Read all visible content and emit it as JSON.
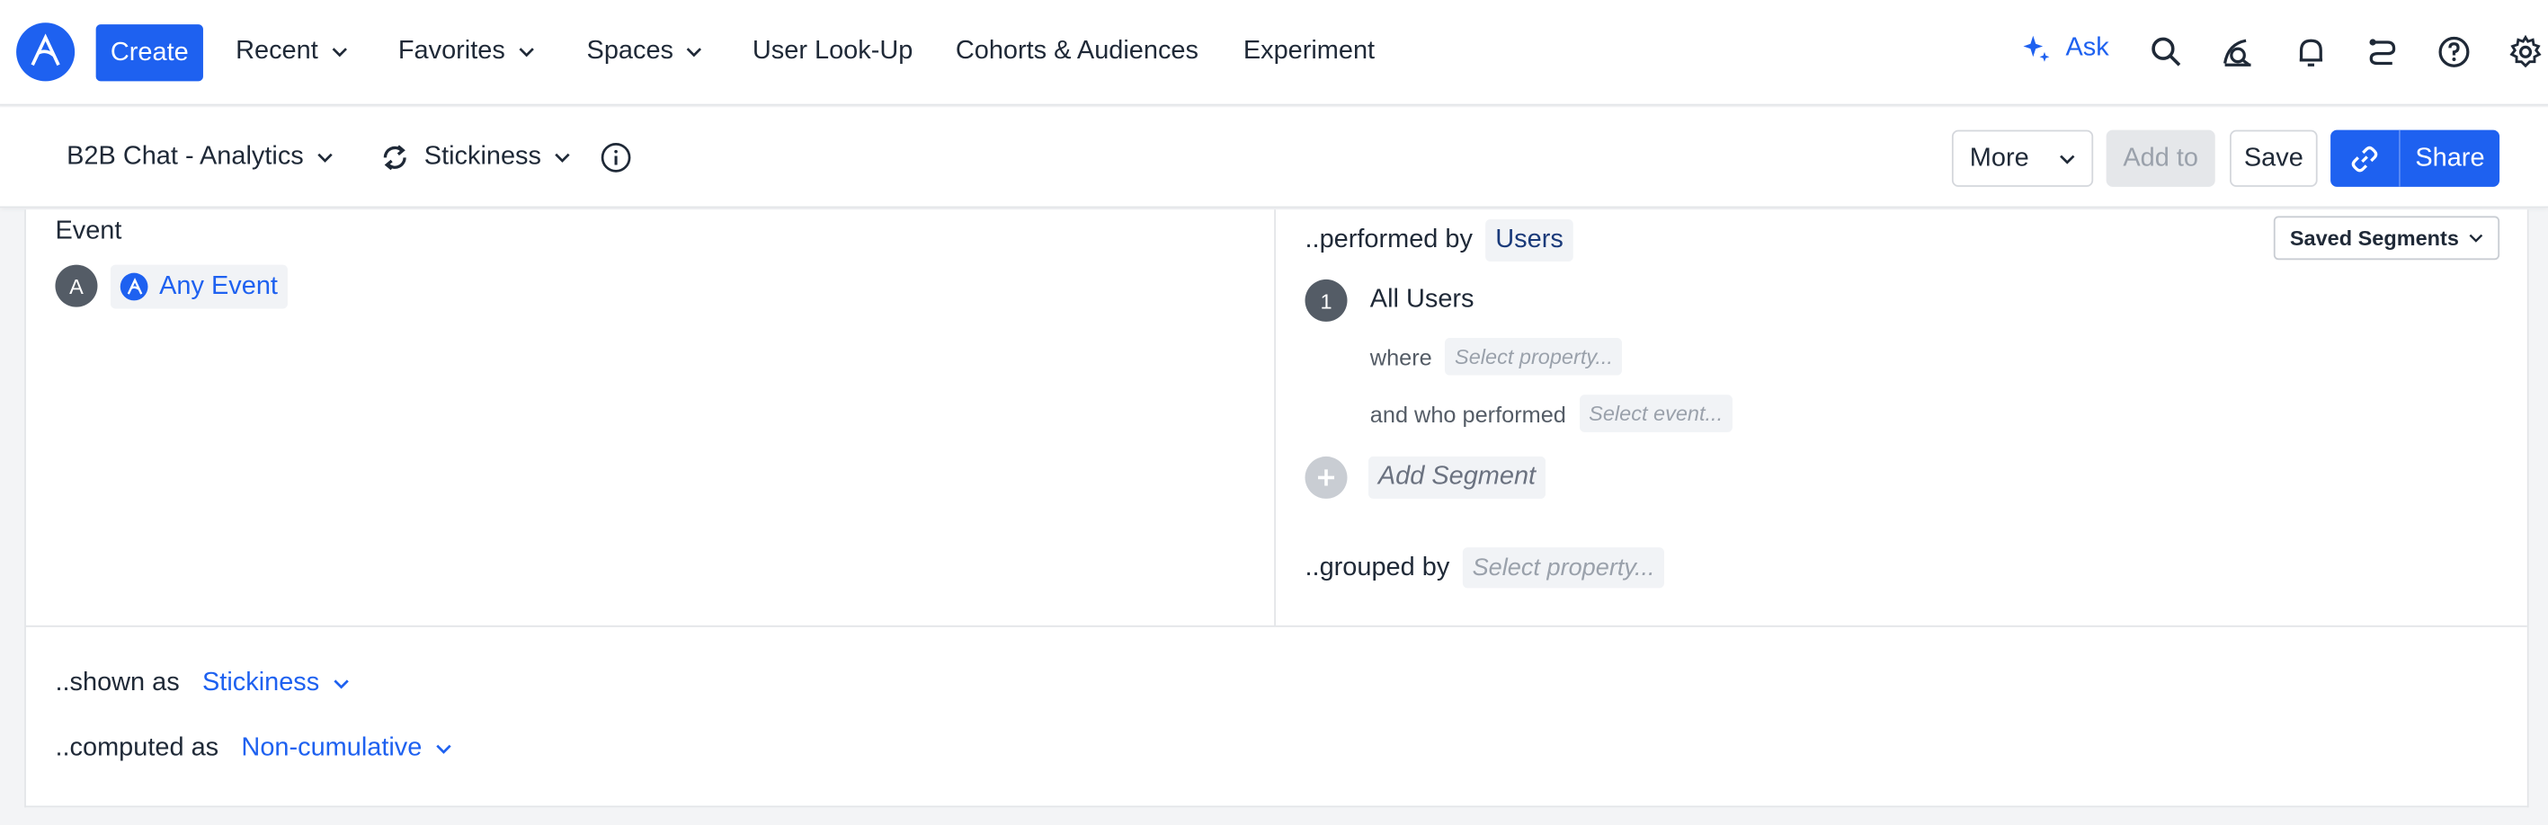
{
  "topnav": {
    "create_label": "Create",
    "items": [
      {
        "label": "Recent",
        "has_chevron": true
      },
      {
        "label": "Favorites",
        "has_chevron": true
      },
      {
        "label": "Spaces",
        "has_chevron": true
      },
      {
        "label": "User Look-Up",
        "has_chevron": false
      },
      {
        "label": "Cohorts & Audiences",
        "has_chevron": false
      },
      {
        "label": "Experiment",
        "has_chevron": false
      }
    ],
    "ask_label": "Ask",
    "icons": [
      "search-icon",
      "inspect-icon",
      "bell-icon",
      "route-icon",
      "help-icon",
      "gear-icon"
    ]
  },
  "subbar": {
    "project_label": "B2B Chat - Analytics",
    "chart_type_label": "Stickiness",
    "more_label": "More",
    "add_to_label": "Add to",
    "save_label": "Save",
    "share_label": "Share"
  },
  "event_section": {
    "title": "Event",
    "badge": "A",
    "event_label": "Any Event"
  },
  "segment_section": {
    "performed_by_label": "..performed by",
    "users_label": "Users",
    "saved_segments_label": "Saved Segments",
    "segment_number": "1",
    "segment_name": "All Users",
    "where_label": "where",
    "select_property_placeholder": "Select property...",
    "who_performed_label": "and who performed",
    "select_event_placeholder": "Select event...",
    "add_segment_label": "Add Segment",
    "grouped_by_label": "..grouped by",
    "grouped_by_placeholder": "Select property..."
  },
  "bottom": {
    "shown_as_label": "..shown as",
    "shown_as_value": "Stickiness",
    "computed_as_label": "..computed as",
    "computed_as_value": "Non-cumulative"
  },
  "colors": {
    "accent": "#1e61f0",
    "text": "#1f2937",
    "muted": "#9aa1ab",
    "border": "#e3e5e8",
    "background": "#f3f4f6"
  }
}
